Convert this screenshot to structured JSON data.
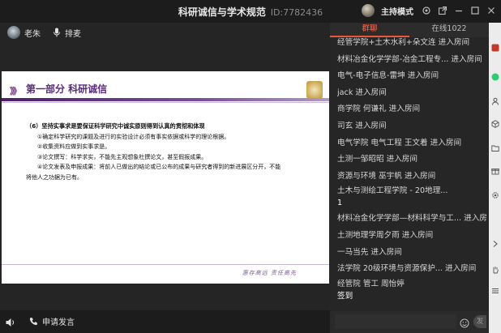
{
  "window": {
    "title": "科研诚信与学术规范",
    "meeting_id": "ID:7782436",
    "host_mode": "主持模式"
  },
  "presenter": {
    "name": "老朱",
    "mic_label": "排麦"
  },
  "slide": {
    "chevrons": "》》",
    "heading": "第一部分 科研诚信",
    "subtitle": "（6）坚持实事求是要保证科学研究中诚实原则得到认真的贯彻和体现",
    "items": [
      "①确定科学研究的课题及进行的实验设计必须有事实依据或科学的理论根据。",
      "②收集资料应做到实事求是。",
      "③论文撰写：科学求实，不能先主观想象杜撰论文，甚至假报成果。",
      "④论文发表及申报成果：将前人已做出的结论或已公布的成果与研究者得到的新进展区分开，不能"
    ],
    "continuation": "将他人之功据为已有。",
    "motto": "惠存高远 责任高先"
  },
  "bottom_bar": {
    "speak_label": "申请发言"
  },
  "panel": {
    "tabs": [
      "群聊",
      "在线1022"
    ],
    "messages": [
      {
        "text": "经管学院+土木水利+朵文连 进入房间",
        "kind": "system"
      },
      {
        "text": "材料冶金化学学部-冶金工程专... 进入房间",
        "kind": "system"
      },
      {
        "text": "电气-电子信息-雷坤 进入房间",
        "kind": "system"
      },
      {
        "text": "jack 进入房间",
        "kind": "system"
      },
      {
        "text": "商学院 何谦礼 进入房间",
        "kind": "system"
      },
      {
        "text": "司玄 进入房间",
        "kind": "system"
      },
      {
        "text": "电气学院 电气工程 王文着 进入房间",
        "kind": "system"
      },
      {
        "text": "土测一邹昭昭 进入房间",
        "kind": "system"
      },
      {
        "text": "资源与环境 巫宇帆 进入房间",
        "kind": "system"
      },
      {
        "text": "土木与测绘工程学院 - 20地理...",
        "kind": "system"
      },
      {
        "text": "1",
        "kind": "body"
      },
      {
        "text": "材料冶金化学学部—材料科学与工... 进入房间",
        "kind": "system"
      },
      {
        "text": "土测地理学周夕雨 进入房间",
        "kind": "system"
      },
      {
        "text": "一马当先 进入房间",
        "kind": "system"
      },
      {
        "text": "法学院 20级环境与资源保护... 进入房间",
        "kind": "system"
      },
      {
        "text": "经管院 管工 周怡婷",
        "kind": "system"
      },
      {
        "text": "签到",
        "kind": "body"
      }
    ],
    "send_label": "发送"
  }
}
